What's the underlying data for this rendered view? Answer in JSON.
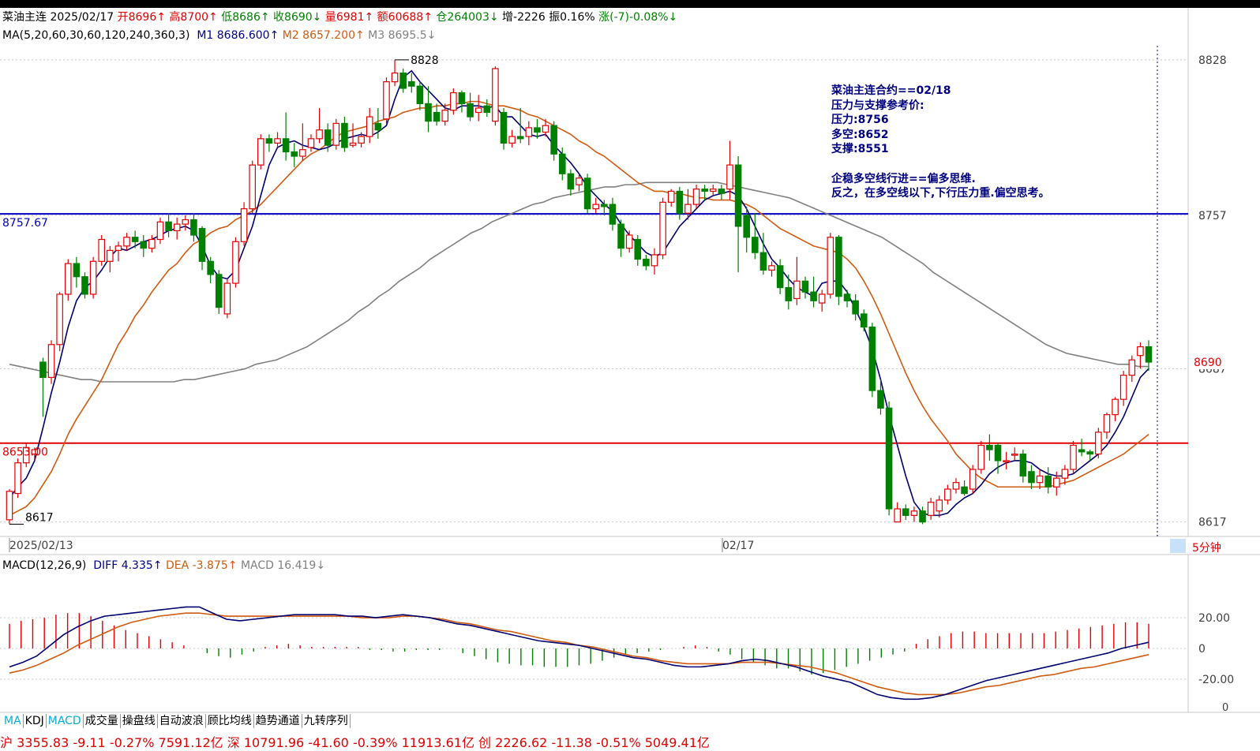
{
  "header": {
    "name": "菜油主连",
    "date": "2025/02/17",
    "open": "开8696↑",
    "high": "高8700↑",
    "low": "低8686↑",
    "close": "收8690↓",
    "volume": "量6981↑",
    "amount": "额60688↑",
    "oi": "仓264003↓",
    "oi_change": "增-2226",
    "amplitude": "振0.16%",
    "change": "涨(-7)-0.08%↓"
  },
  "ma_info": {
    "label": "MA(5,20,60,30,60,120,240,360,3)",
    "m1": "M1 8686.600↑",
    "m2": "M2 8657.200↑",
    "m3": "M3 8695.5↓"
  },
  "macd_info": {
    "label": "MACD(12,26,9)",
    "diff": "DIFF 4.335↑",
    "dea": "DEA -3.875↑",
    "macd": "MACD 16.419↓"
  },
  "annotation": {
    "lines": [
      "菜油主连合约==02/18",
      "压力与支撑参考价:",
      "压力:8756",
      "多空:8652",
      "支撑:8551",
      "",
      "企稳多空线行进==偏多思维.",
      "反之，在多空线以下,下行压力重.偏空思考。"
    ]
  },
  "levels": {
    "blue_line_label": "8757.67",
    "red_line_label": "8653.00",
    "high_label": "8828",
    "low_label": "8617",
    "last_price": "8690"
  },
  "axes": {
    "price_ticks": [
      "8828",
      "8757",
      "8687",
      "8617"
    ],
    "date_labels": [
      "2025/02/13",
      "02/17"
    ],
    "macd_ticks": [
      "20.00",
      "0",
      "-20.00",
      "0"
    ],
    "period": "5分钟"
  },
  "tabs": [
    "MA",
    "KDJ",
    "MACD",
    "成交量",
    "操盘线",
    "自动波浪",
    "顾比均线",
    "趋势通道",
    "九转序列"
  ],
  "status_bar": "沪 3355.83 -9.11 -0.27% 7591.12亿      深 10791.96 -41.60 -0.39% 11913.61亿      创 2226.62 -11.38 -0.51% 5049.41亿",
  "colors": {
    "up": "#e00000",
    "down": "#008000",
    "ma1": "#000070",
    "ma2": "#d05a10",
    "ma3": "#808080",
    "blue_level": "#0000c0",
    "red_level": "#e00000"
  },
  "chart_data": {
    "type": "candlestick",
    "ylim": [
      8614,
      8833
    ],
    "resistance": 8757.67,
    "support": 8653.0,
    "candles": [
      [
        8618,
        8631,
        8616,
        8632
      ],
      [
        8630,
        8644,
        8628,
        8646
      ],
      [
        8644,
        8651,
        8642,
        8653
      ],
      [
        8648,
        8650,
        8645,
        8651
      ],
      [
        8690,
        8683,
        8665,
        8692
      ],
      [
        8683,
        8698,
        8680,
        8700
      ],
      [
        8698,
        8721,
        8695,
        8722
      ],
      [
        8721,
        8735,
        8718,
        8737
      ],
      [
        8735,
        8729,
        8724,
        8738
      ],
      [
        8729,
        8721,
        8719,
        8731
      ],
      [
        8721,
        8736,
        8719,
        8738
      ],
      [
        8736,
        8746,
        8734,
        8748
      ],
      [
        8736,
        8741,
        8731,
        8743
      ],
      [
        8741,
        8743,
        8736,
        8745
      ],
      [
        8743,
        8747,
        8741,
        8749
      ],
      [
        8747,
        8745,
        8742,
        8750
      ],
      [
        8745,
        8742,
        8738,
        8748
      ],
      [
        8742,
        8746,
        8740,
        8748
      ],
      [
        8746,
        8754,
        8744,
        8756
      ],
      [
        8754,
        8750,
        8747,
        8758
      ],
      [
        8750,
        8753,
        8746,
        8756
      ],
      [
        8753,
        8755,
        8750,
        8757
      ],
      [
        8755,
        8748,
        8745,
        8758
      ],
      [
        8751,
        8736,
        8732,
        8752
      ],
      [
        8736,
        8730,
        8726,
        8738
      ],
      [
        8730,
        8715,
        8712,
        8732
      ],
      [
        8712,
        8726,
        8710,
        8728
      ],
      [
        8726,
        8745,
        8724,
        8747
      ],
      [
        8745,
        8760,
        8743,
        8763
      ],
      [
        8760,
        8780,
        8758,
        8782
      ],
      [
        8780,
        8792,
        8778,
        8794
      ],
      [
        8792,
        8790,
        8786,
        8794
      ],
      [
        8790,
        8792,
        8788,
        8795
      ],
      [
        8792,
        8786,
        8782,
        8804
      ],
      [
        8786,
        8784,
        8779,
        8790
      ],
      [
        8784,
        8787,
        8782,
        8799
      ],
      [
        8788,
        8792,
        8786,
        8794
      ],
      [
        8792,
        8796,
        8790,
        8806
      ],
      [
        8796,
        8789,
        8786,
        8799
      ],
      [
        8789,
        8799,
        8787,
        8801
      ],
      [
        8799,
        8788,
        8786,
        8802
      ],
      [
        8789,
        8790,
        8788,
        8799
      ],
      [
        8790,
        8793,
        8788,
        8795
      ],
      [
        8793,
        8802,
        8790,
        8806
      ],
      [
        8799,
        8796,
        8792,
        8806
      ],
      [
        8801,
        8818,
        8799,
        8820
      ],
      [
        8818,
        8822,
        8816,
        8828
      ],
      [
        8822,
        8815,
        8813,
        8824
      ],
      [
        8818,
        8816,
        8813,
        8822
      ],
      [
        8816,
        8808,
        8805,
        8818
      ],
      [
        8808,
        8800,
        8795,
        8816
      ],
      [
        8804,
        8800,
        8798,
        8808
      ],
      [
        8800,
        8805,
        8798,
        8808
      ],
      [
        8805,
        8813,
        8803,
        8815
      ],
      [
        8813,
        8808,
        8804,
        8814
      ],
      [
        8808,
        8802,
        8800,
        8813
      ],
      [
        8804,
        8806,
        8800,
        8812
      ],
      [
        8807,
        8804,
        8802,
        8810
      ],
      [
        8800,
        8824,
        8798,
        8825
      ],
      [
        8804,
        8790,
        8787,
        8806
      ],
      [
        8790,
        8793,
        8788,
        8796
      ],
      [
        8793,
        8792,
        8790,
        8806
      ],
      [
        8793,
        8797,
        8789,
        8800
      ],
      [
        8797,
        8795,
        8792,
        8801
      ],
      [
        8795,
        8798,
        8793,
        8801
      ],
      [
        8798,
        8785,
        8782,
        8800
      ],
      [
        8785,
        8776,
        8773,
        8788
      ],
      [
        8776,
        8769,
        8766,
        8778
      ],
      [
        8771,
        8774,
        8768,
        8776
      ],
      [
        8774,
        8760,
        8758,
        8776
      ],
      [
        8760,
        8762,
        8758,
        8765
      ],
      [
        8762,
        8761,
        8757,
        8764
      ],
      [
        8762,
        8753,
        8750,
        8765
      ],
      [
        8753,
        8742,
        8738,
        8755
      ],
      [
        8742,
        8748,
        8740,
        8750
      ],
      [
        8746,
        8737,
        8734,
        8748
      ],
      [
        8737,
        8734,
        8732,
        8739
      ],
      [
        8734,
        8739,
        8730,
        8742
      ],
      [
        8739,
        8763,
        8737,
        8765
      ],
      [
        8763,
        8768,
        8761,
        8769
      ],
      [
        8768,
        8758,
        8755,
        8770
      ],
      [
        8758,
        8762,
        8755,
        8769
      ],
      [
        8762,
        8769,
        8760,
        8771
      ],
      [
        8769,
        8768,
        8764,
        8771
      ],
      [
        8768,
        8769,
        8766,
        8771
      ],
      [
        8769,
        8767,
        8764,
        8771
      ],
      [
        8769,
        8780,
        8764,
        8791
      ],
      [
        8780,
        8752,
        8731,
        8784
      ],
      [
        8757,
        8747,
        8740,
        8761
      ],
      [
        8747,
        8740,
        8737,
        8758
      ],
      [
        8740,
        8732,
        8730,
        8749
      ],
      [
        8732,
        8734,
        8729,
        8736
      ],
      [
        8734,
        8724,
        8721,
        8737
      ],
      [
        8724,
        8718,
        8714,
        8730
      ],
      [
        8719,
        8727,
        8716,
        8738
      ],
      [
        8727,
        8722,
        8719,
        8729
      ],
      [
        8722,
        8718,
        8715,
        8729
      ],
      [
        8717,
        8721,
        8713,
        8723
      ],
      [
        8721,
        8747,
        8719,
        8749
      ],
      [
        8747,
        8720,
        8716,
        8748
      ],
      [
        8721,
        8718,
        8715,
        8723
      ],
      [
        8718,
        8712,
        8709,
        8721
      ],
      [
        8712,
        8706,
        8704,
        8714
      ],
      [
        8706,
        8677,
        8674,
        8708
      ],
      [
        8677,
        8669,
        8666,
        8682
      ],
      [
        8669,
        8623,
        8620,
        8672
      ],
      [
        8617,
        8623,
        8617,
        8626
      ],
      [
        8623,
        8620,
        8618,
        8625
      ],
      [
        8620,
        8622,
        8617,
        8624
      ],
      [
        8622,
        8617,
        8616,
        8624
      ],
      [
        8620,
        8626,
        8618,
        8628
      ],
      [
        8622,
        8627,
        8619,
        8629
      ],
      [
        8627,
        8632,
        8625,
        8634
      ],
      [
        8632,
        8635,
        8630,
        8637
      ],
      [
        8633,
        8630,
        8629,
        8636
      ],
      [
        8632,
        8641,
        8630,
        8643
      ],
      [
        8641,
        8652,
        8639,
        8654
      ],
      [
        8652,
        8650,
        8645,
        8657
      ],
      [
        8652,
        8645,
        8639,
        8653
      ],
      [
        8645,
        8645,
        8641,
        8649
      ],
      [
        8648,
        8648,
        8645,
        8651
      ],
      [
        8648,
        8638,
        8635,
        8650
      ],
      [
        8640,
        8635,
        8632,
        8643
      ],
      [
        8635,
        8638,
        8632,
        8641
      ],
      [
        8638,
        8633,
        8630,
        8642
      ],
      [
        8633,
        8637,
        8629,
        8640
      ],
      [
        8637,
        8641,
        8634,
        8643
      ],
      [
        8641,
        8652,
        8639,
        8654
      ],
      [
        8650,
        8649,
        8647,
        8655
      ],
      [
        8649,
        8648,
        8645,
        8650
      ],
      [
        8648,
        8658,
        8646,
        8660
      ],
      [
        8658,
        8666,
        8655,
        8667
      ],
      [
        8666,
        8673,
        8663,
        8674
      ],
      [
        8673,
        8684,
        8670,
        8686
      ],
      [
        8684,
        8691,
        8681,
        8693
      ],
      [
        8693,
        8697,
        8687,
        8699
      ],
      [
        8697,
        8690,
        8686,
        8700
      ]
    ],
    "ma1": [
      8628,
      8633,
      8637,
      8645,
      8660,
      8676,
      8690,
      8706,
      8718,
      8724,
      8727,
      8732,
      8738,
      8742,
      8741,
      8743,
      8745,
      8746,
      8748,
      8750,
      8751,
      8752,
      8750,
      8743,
      8734,
      8729,
      8728,
      8732,
      8742,
      8752,
      8766,
      8780,
      8788,
      8790,
      8791,
      8789,
      8788,
      8787,
      8788,
      8790,
      8792,
      8793,
      8794,
      8793,
      8795,
      8798,
      8810,
      8820,
      8823,
      8818,
      8814,
      8810,
      8806,
      8805,
      8807,
      8807,
      8807,
      8806,
      8807,
      8802,
      8802,
      8798,
      8794,
      8793,
      8794,
      8789,
      8785,
      8781,
      8776,
      8770,
      8766,
      8762,
      8759,
      8753,
      8748,
      8744,
      8740,
      8738,
      8740,
      8746,
      8752,
      8756,
      8760,
      8764,
      8766,
      8767,
      8768,
      8766,
      8760,
      8752,
      8744,
      8737,
      8733,
      8728,
      8724,
      8722,
      8720,
      8726,
      8727,
      8727,
      8722,
      8714,
      8706,
      8696,
      8682,
      8666,
      8652,
      8638,
      8626,
      8621,
      8620,
      8620,
      8621,
      8625,
      8628,
      8630,
      8634,
      8639,
      8642,
      8644,
      8645,
      8645,
      8644,
      8641,
      8639,
      8638,
      8638,
      8639,
      8642,
      8645,
      8648,
      8652,
      8658,
      8665,
      8674,
      8683,
      8687
    ],
    "ma2": [
      8620,
      8622,
      8624,
      8628,
      8634,
      8640,
      8648,
      8657,
      8664,
      8670,
      8676,
      8682,
      8690,
      8698,
      8704,
      8711,
      8716,
      8722,
      8727,
      8732,
      8735,
      8740,
      8744,
      8746,
      8749,
      8751,
      8752,
      8755,
      8757,
      8759,
      8762,
      8766,
      8770,
      8774,
      8778,
      8782,
      8785,
      8787,
      8790,
      8793,
      8795,
      8796,
      8797,
      8798,
      8800,
      8801,
      8802,
      8804,
      8805,
      8806,
      8806,
      8807,
      8807,
      8808,
      8808,
      8809,
      8809,
      8808,
      8807,
      8807,
      8806,
      8805,
      8803,
      8802,
      8800,
      8798,
      8796,
      8794,
      8791,
      8789,
      8786,
      8784,
      8781,
      8778,
      8775,
      8772,
      8770,
      8768,
      8768,
      8767,
      8767,
      8766,
      8765,
      8765,
      8764,
      8764,
      8764,
      8763,
      8762,
      8760,
      8757,
      8754,
      8751,
      8749,
      8747,
      8745,
      8743,
      8742,
      8741,
      8740,
      8737,
      8733,
      8727,
      8720,
      8712,
      8703,
      8694,
      8685,
      8677,
      8670,
      8664,
      8659,
      8654,
      8648,
      8644,
      8640,
      8637,
      8635,
      8633,
      8633,
      8633,
      8633,
      8633,
      8633,
      8633,
      8634,
      8635,
      8636,
      8638,
      8640,
      8642,
      8644,
      8646,
      8648,
      8651,
      8654,
      8657
    ],
    "ma3": [
      8689,
      8688,
      8687,
      8686,
      8685,
      8684,
      8683,
      8682,
      8682,
      8681,
      8681,
      8681,
      8681,
      8681,
      8681,
      8681,
      8681,
      8682,
      8682,
      8683,
      8684,
      8685,
      8686,
      8687,
      8689,
      8690,
      8691,
      8693,
      8695,
      8697,
      8700,
      8703,
      8706,
      8709,
      8713,
      8716,
      8720,
      8723,
      8727,
      8730,
      8733,
      8737,
      8740,
      8743,
      8746,
      8749,
      8751,
      8754,
      8756,
      8758,
      8760,
      8762,
      8763,
      8765,
      8766,
      8767,
      8768,
      8769,
      8770,
      8770,
      8771,
      8771,
      8772,
      8772,
      8772,
      8772,
      8772,
      8772,
      8772,
      8772,
      8771,
      8770,
      8769,
      8768,
      8767,
      8766,
      8765,
      8763,
      8761,
      8759,
      8757,
      8755,
      8753,
      8751,
      8749,
      8747,
      8744,
      8741,
      8738,
      8735,
      8731,
      8728,
      8725,
      8722,
      8719,
      8716,
      8713,
      8710,
      8707,
      8704,
      8701,
      8698,
      8696,
      8694,
      8693,
      8692,
      8691,
      8690,
      8689,
      8689,
      8688,
      8688
    ],
    "macd_ylim": [
      -38,
      38
    ],
    "diff": [
      -12,
      -9,
      -5,
      2,
      9,
      14,
      18,
      21,
      22,
      23,
      24,
      25,
      26,
      27,
      27,
      23,
      19,
      18,
      19,
      20,
      21,
      22,
      22,
      22,
      22,
      21,
      21,
      20,
      21,
      22,
      21,
      20,
      18,
      16,
      15,
      13,
      11,
      9,
      7,
      5,
      4,
      3,
      2,
      0,
      -2,
      -4,
      -6,
      -7,
      -9,
      -11,
      -12,
      -12,
      -11,
      -10,
      -8,
      -7,
      -8,
      -10,
      -12,
      -15,
      -18,
      -20,
      -22,
      -26,
      -30,
      -32,
      -33,
      -33,
      -32,
      -30,
      -27,
      -24,
      -21,
      -19,
      -17,
      -15,
      -13,
      -11,
      -9,
      -7,
      -5,
      -3,
      0,
      2,
      4
    ],
    "dea": [
      -16,
      -14,
      -11,
      -7,
      -3,
      2,
      6,
      10,
      14,
      17,
      19,
      21,
      22,
      23,
      23,
      22,
      21,
      21,
      21,
      21,
      21,
      21,
      21,
      21,
      21,
      21,
      20,
      20,
      20,
      21,
      21,
      20,
      19,
      17,
      16,
      14,
      12,
      11,
      9,
      7,
      5,
      4,
      2,
      1,
      -1,
      -3,
      -5,
      -6,
      -8,
      -9,
      -10,
      -10,
      -10,
      -10,
      -9,
      -9,
      -9,
      -10,
      -11,
      -12,
      -14,
      -16,
      -19,
      -22,
      -25,
      -27,
      -29,
      -30,
      -30,
      -30,
      -29,
      -27,
      -25,
      -24,
      -22,
      -20,
      -18,
      -17,
      -15,
      -13,
      -12,
      -10,
      -8,
      -6,
      -4
    ],
    "macd": [
      16,
      18,
      19,
      20,
      22,
      23,
      23,
      21,
      18,
      15,
      12,
      10,
      8,
      6,
      4,
      2,
      0,
      -3,
      -5,
      -6,
      -4,
      -2,
      1,
      2,
      3,
      2,
      1,
      1,
      1,
      1,
      1,
      -1,
      -1,
      -2,
      -2,
      -1,
      -1,
      -1,
      0,
      -3,
      -5,
      -7,
      -9,
      -10,
      -11,
      -11,
      -12,
      -12,
      -12,
      -11,
      -10,
      -8,
      -6,
      -4,
      -3,
      -2,
      -1,
      0,
      1,
      2,
      1,
      -2,
      -4,
      -7,
      -9,
      -11,
      -13,
      -13,
      -15,
      -17,
      -16,
      -14,
      -12,
      -10,
      -8,
      -6,
      -4,
      -2,
      3,
      6,
      8,
      10,
      11,
      11,
      10,
      10,
      10,
      10,
      10,
      10,
      11,
      12,
      13,
      14,
      15,
      16,
      17,
      17,
      16
    ]
  }
}
